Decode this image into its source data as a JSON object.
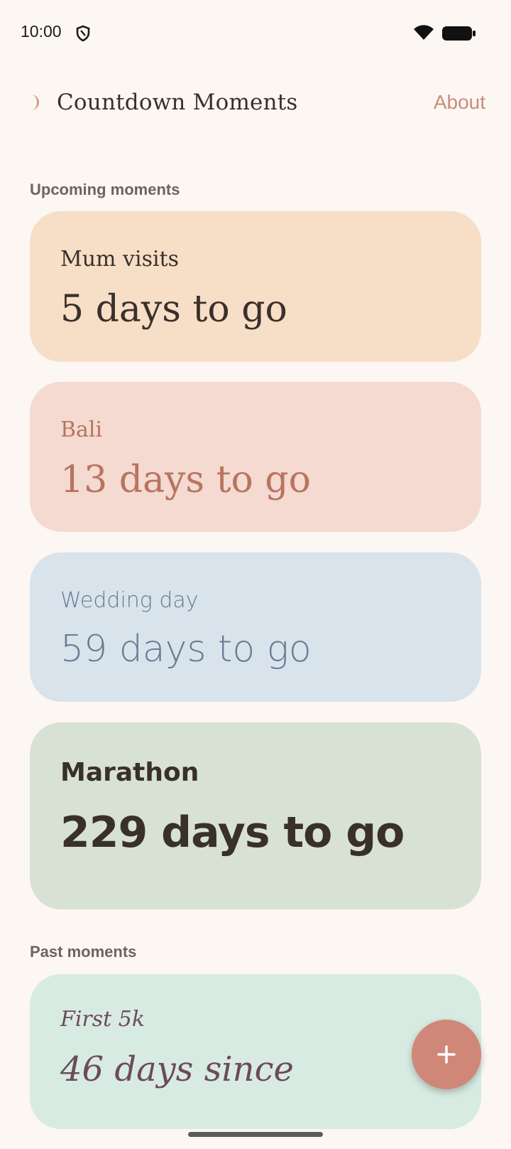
{
  "status_bar": {
    "time": "10:00",
    "icons": [
      "shield-icon",
      "wifi-icon",
      "battery-icon"
    ]
  },
  "header": {
    "title": "Countdown Moments",
    "about_label": "About",
    "logo_icon": "crescent-moon-icon"
  },
  "sections": {
    "upcoming_label": "Upcoming moments",
    "past_label": "Past moments"
  },
  "upcoming": [
    {
      "name": "Mum visits",
      "count": "5 days to go",
      "bg": "#f7dec7",
      "fg": "#3a302a"
    },
    {
      "name": "Bali",
      "count": "13 days to go",
      "bg": "#f4dad0",
      "fg": "#b87460"
    },
    {
      "name": "Wedding day",
      "count": "59 days to go",
      "bg": "#d8e3ec",
      "fg": "#6a7a92"
    },
    {
      "name": "Marathon",
      "count": "229 days to go",
      "bg": "#d8e2d2",
      "fg": "#3a302a"
    }
  ],
  "past": [
    {
      "name": "First 5k",
      "count": "46 days since",
      "bg": "#d8ebe2",
      "fg": "#6c4a5c"
    }
  ],
  "fab": {
    "icon": "plus-icon",
    "color": "#cf8878"
  },
  "colors": {
    "background": "#fcf7f2",
    "accent": "#c98c7c"
  }
}
